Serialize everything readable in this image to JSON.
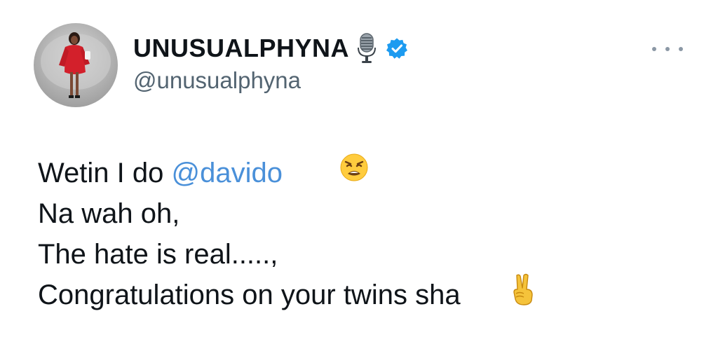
{
  "tweet": {
    "author": {
      "display_name": "UNUSUALPHYNA",
      "handle": "@unusualphyna",
      "badges": [
        "microphone-icon",
        "verified-badge-icon"
      ],
      "verified_color": "#1d9bf0"
    },
    "more_menu_icon": "more-horizontal-icon",
    "body": {
      "line1_text": "Wetin I do ",
      "line1_mention": "@davido",
      "line1_emoji": "weary-face-emoji",
      "line2_text": "Na wah oh,",
      "line3_text": "The hate is real.....,",
      "line4_text": "Congratulations on your twins sha",
      "line4_emoji": "victory-hand-emoji"
    },
    "colors": {
      "text": "#0f1419",
      "handle": "#536471",
      "mention": "#4a90d9"
    }
  }
}
